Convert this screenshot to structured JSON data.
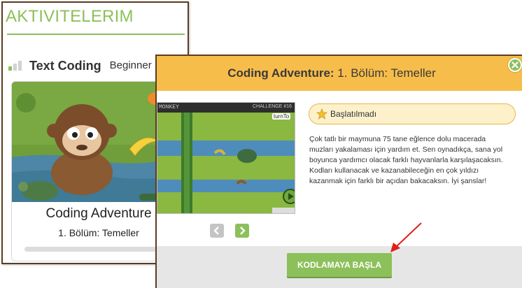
{
  "left_panel": {
    "title": "AKTIVITELERIM",
    "level_name": "Text Coding",
    "level_tag": "Beginner",
    "course": {
      "title": "Coding Adventure",
      "subtitle": "1. Bölüm: Temeller",
      "progress": 0
    }
  },
  "modal": {
    "title_bold": "Coding Adventure:",
    "title_rest": " 1. Bölüm: Temeller",
    "game": {
      "bar_left": "MONKEY",
      "bar_right": "CHALLENGE #16",
      "turn_label": "turnTo"
    },
    "status": {
      "icon": "star-icon",
      "label": "Başlatılmadı"
    },
    "description_lines": [
      "Çok tatlı bir maymuna 75 tane eğlence dolu macerada",
      "muzları yakalaması için yardım et. Sen oynadıkça, sana yol",
      "boyunca yardımcı olacak farklı hayvanlarla karşılaşacaksın.",
      "Kodları kullanacak ve kazanabileceğin en çok yıldızı",
      "kazanmak için farklı bir açıdan bakacaksın. İyi şanslar!"
    ],
    "start_button": "KODLAMAYA BAŞLA"
  },
  "colors": {
    "accent_green": "#8cc05a",
    "header_yellow": "#f7bd4a",
    "frame_brown": "#5a3d22",
    "arrow_red": "#e0201b"
  }
}
